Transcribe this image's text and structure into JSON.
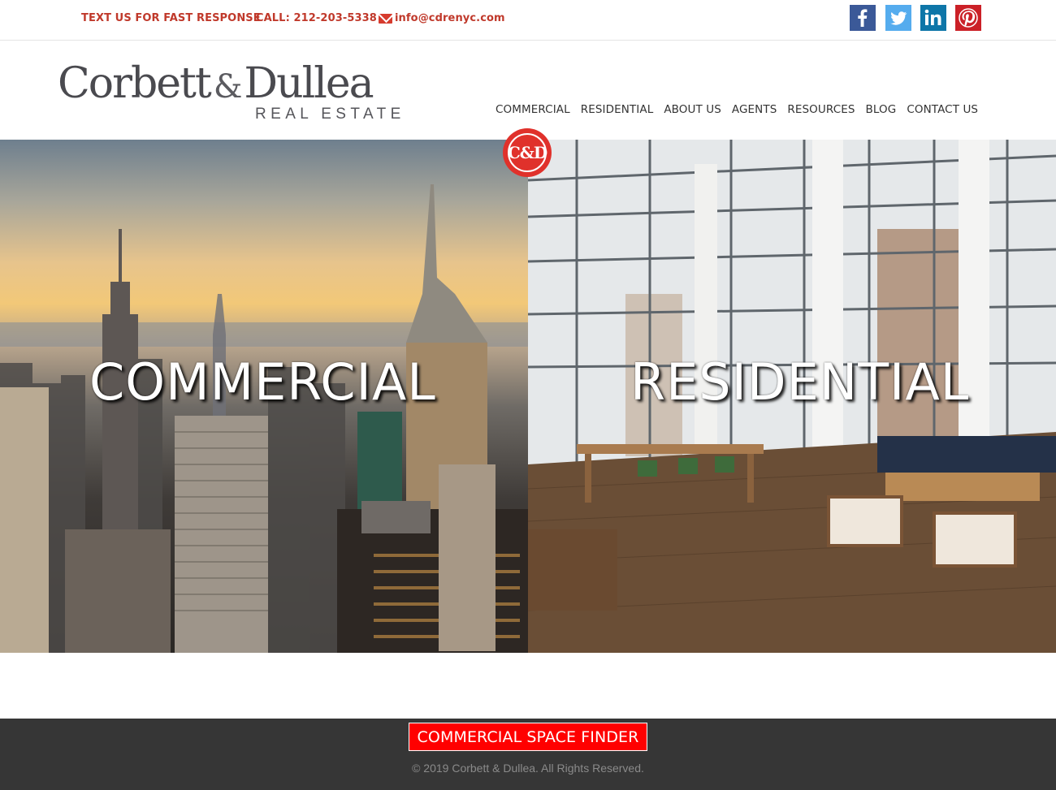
{
  "topbar": {
    "text_us": "TEXT US FOR FAST RESPONSE",
    "call": "CALL: 212-203-5338",
    "email": "info@cdrenyc.com"
  },
  "social": [
    {
      "name": "facebook",
      "icon": "facebook-icon",
      "color": "#3b5998"
    },
    {
      "name": "twitter",
      "icon": "twitter-icon",
      "color": "#55acee"
    },
    {
      "name": "linkedin",
      "icon": "linkedin-icon",
      "color": "#0e76a8"
    },
    {
      "name": "pinterest",
      "icon": "pinterest-icon",
      "color": "#cb2027"
    }
  ],
  "logo": {
    "name_left": "Corbett",
    "amp": "&",
    "name_right": "Dullea",
    "tagline": "REAL ESTATE"
  },
  "nav": {
    "commercial": "COMMERCIAL",
    "residential": "RESIDENTIAL",
    "about": "ABOUT US",
    "agents": "AGENTS",
    "resources": "RESOURCES",
    "blog": "BLOG",
    "contact": "CONTACT US"
  },
  "hero": {
    "badge": "C&D",
    "left_label": "COMMERCIAL",
    "right_label": "RESIDENTIAL"
  },
  "footer": {
    "finder_button": "COMMERCIAL SPACE FINDER",
    "copyright": "© 2019 Corbett & Dullea. All Rights Reserved.",
    "button_color": "#ff0000"
  },
  "colors": {
    "accent_red": "#c0392b",
    "footer_bg": "#363636"
  }
}
